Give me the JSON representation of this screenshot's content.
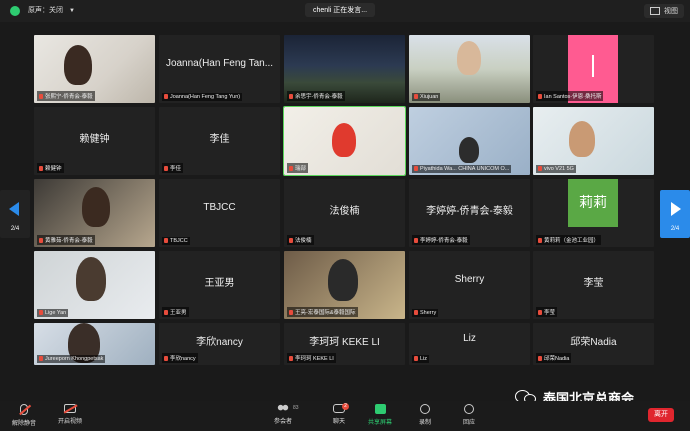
{
  "topbar": {
    "audio_label": "原声：关闭",
    "speaking": "chenli 正在发言...",
    "view_label": "视图"
  },
  "pager": {
    "left_page": "2/4",
    "right_page": "2/4"
  },
  "tiles": [
    {
      "name": "张熙宁-侨青会-泰毅",
      "big": ""
    },
    {
      "name": "Joanna(Han Feng Tang Yun)",
      "big": "Joanna(Han Feng Tan..."
    },
    {
      "name": "余思宇-侨青会-泰毅",
      "big": ""
    },
    {
      "name": "Xiujuan",
      "big": ""
    },
    {
      "name": "Ian Santos-伊恩·桑托斯",
      "big": ""
    },
    {
      "name": "赖健钟",
      "big": "赖健钟"
    },
    {
      "name": "李佳",
      "big": "李佳"
    },
    {
      "name": "瑞部",
      "big": ""
    },
    {
      "name": "Piyathida Wa... CHINA UNICOM O...",
      "big": ""
    },
    {
      "name": "vivo V21 5G",
      "big": ""
    },
    {
      "name": "黄雅茹-侨青会-泰毅",
      "big": ""
    },
    {
      "name": "TBJCC",
      "big": "TBJCC"
    },
    {
      "name": "法俊楠",
      "big": "法俊楠"
    },
    {
      "name": "李婷婷-侨青会-泰毅",
      "big": "李婷婷-侨青会-泰毅"
    },
    {
      "name": "黄莉莉（金池工业园）",
      "big": "莉莉"
    },
    {
      "name": "Lige Yan",
      "big": ""
    },
    {
      "name": "王亚男",
      "big": "王亚男"
    },
    {
      "name": "王亮-宏泰国际&泰毅国际",
      "big": ""
    },
    {
      "name": "Sherry",
      "big": "Sherry"
    },
    {
      "name": "李莹",
      "big": "李莹"
    },
    {
      "name": "Jureeporn Khongpetsak",
      "big": ""
    },
    {
      "name": "李欣nancy",
      "big": "李欣nancy"
    },
    {
      "name": "李珂珂 KEKE LI",
      "big": "李珂珂 KEKE LI"
    },
    {
      "name": "Liz",
      "big": "Liz"
    },
    {
      "name": "邱荣Nadia",
      "big": "邱荣Nadia"
    }
  ],
  "toolbar": {
    "unmute": "解除静音",
    "start_video": "开启视频",
    "participants": "参会者",
    "participants_count": "83",
    "chat": "聊天",
    "chat_badge": "2",
    "share": "共享屏幕",
    "record": "录制",
    "reactions": "回应",
    "leave": "离开"
  },
  "watermark": "泰国北京总商会",
  "colors": {
    "accent_blue": "#2b8bea",
    "share_green": "#2ecc71",
    "leave_red": "#e0262e",
    "tile_pink": "#ff5b91",
    "tile_green": "#5aa845"
  }
}
